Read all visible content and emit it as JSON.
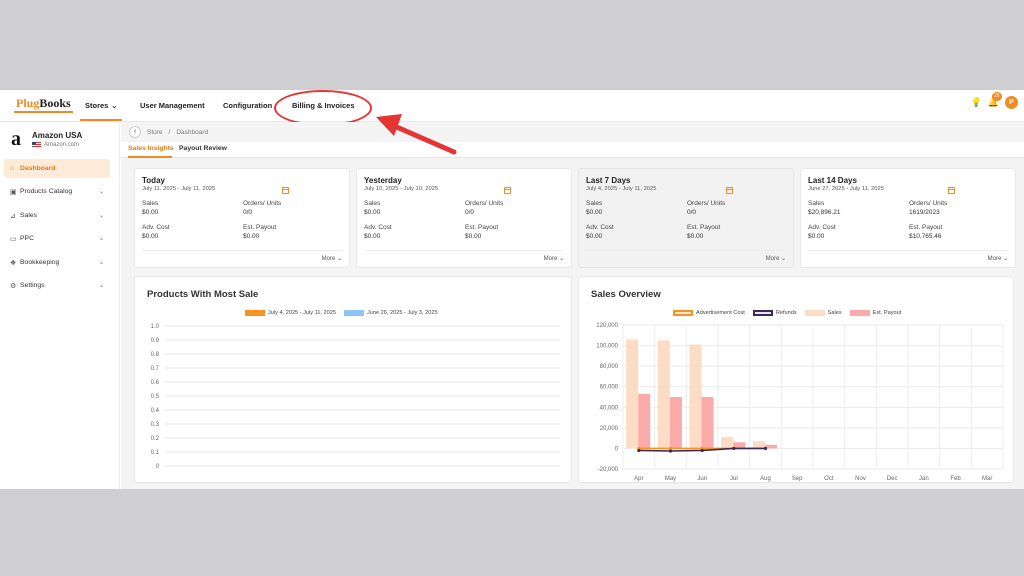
{
  "brand": {
    "logo_prefix": "Plug",
    "logo_suffix": "Books"
  },
  "topnav": {
    "items": [
      {
        "label": "Stores"
      },
      {
        "label": "User Management"
      },
      {
        "label": "Configuration"
      },
      {
        "label": "Billing & Invoices"
      }
    ],
    "notification_count": "26",
    "avatar_initial": "P"
  },
  "store": {
    "name": "Amazon USA",
    "domain": "Amazon.com"
  },
  "sidebar": {
    "items": [
      {
        "label": "Dashboard",
        "icon": "home-icon"
      },
      {
        "label": "Products Catalog",
        "icon": "box-icon"
      },
      {
        "label": "Sales",
        "icon": "sales-chart-icon"
      },
      {
        "label": "PPC",
        "icon": "ppc-icon"
      },
      {
        "label": "Bookkeeping",
        "icon": "book-icon"
      },
      {
        "label": "Settings",
        "icon": "gear-icon"
      }
    ]
  },
  "breadcrumb": {
    "parent": "Store",
    "separator": "/",
    "current": "Dashboard"
  },
  "subtabs": [
    {
      "label": "Sales Insights"
    },
    {
      "label": "Payout Review"
    }
  ],
  "cards": [
    {
      "title": "Today",
      "range": "July 11, 2025 - July 11, 2025",
      "sales_label": "Sales",
      "sales": "$0.00",
      "orders_label": "Orders/ Units",
      "orders": "0/0",
      "adv_label": "Adv. Cost",
      "adv": "$0.00",
      "payout_label": "Est. Payout",
      "payout": "$0.00",
      "more": "More"
    },
    {
      "title": "Yesterday",
      "range": "July 10, 2025 - July 10, 2025",
      "sales_label": "Sales",
      "sales": "$0.00",
      "orders_label": "Orders/ Units",
      "orders": "0/0",
      "adv_label": "Adv. Cost",
      "adv": "$0.00",
      "payout_label": "Est. Payout",
      "payout": "$0.00",
      "more": "More"
    },
    {
      "title": "Last 7 Days",
      "range": "July 4, 2025 - July 11, 2025",
      "sales_label": "Sales",
      "sales": "$0.00",
      "orders_label": "Orders/ Units",
      "orders": "0/0",
      "adv_label": "Adv. Cost",
      "adv": "$0.00",
      "payout_label": "Est. Payout",
      "payout": "$0.00",
      "more": "More"
    },
    {
      "title": "Last 14 Days",
      "range": "June 27, 2025 - July 11, 2025",
      "sales_label": "Sales",
      "sales": "$20,896.21",
      "orders_label": "Orders/ Units",
      "orders": "1619/2023",
      "adv_label": "Adv. Cost",
      "adv": "$0.00",
      "payout_label": "Est. Payout",
      "payout": "$10,765.46",
      "more": "More"
    }
  ],
  "colors": {
    "accent": "#f08a24",
    "highlight": "#e63333"
  },
  "chart_data": [
    {
      "type": "bar",
      "title": "Products With Most Sale",
      "series": [
        {
          "name": "July 4, 2025 - July 11, 2025",
          "color": "#f7931e",
          "values": []
        },
        {
          "name": "June 26, 2025 - July 3, 2025",
          "color": "#8ec5f2",
          "values": []
        }
      ],
      "ylim": [
        0,
        1.0
      ],
      "yticks": [
        "1.0",
        "0.9",
        "0.8",
        "0.7",
        "0.6",
        "0.5",
        "0.4",
        "0.3",
        "0.2",
        "0.1",
        "0"
      ],
      "grid": true
    },
    {
      "type": "bar",
      "title": "Sales Overview",
      "categories": [
        "Apr",
        "May",
        "Jun",
        "Jul",
        "Aug",
        "Sep",
        "Oct",
        "Nov",
        "Dec",
        "Jan",
        "Feb",
        "Mar"
      ],
      "series": [
        {
          "name": "Advertisement Cost",
          "kind": "line",
          "color": "#f7931e",
          "values": [
            0,
            0,
            0,
            0,
            0,
            0,
            0,
            0,
            0,
            0,
            0,
            0
          ]
        },
        {
          "name": "Refunds",
          "kind": "line",
          "color": "#3a2a55",
          "values": [
            -2000,
            -2500,
            -2000,
            0,
            0,
            0,
            0,
            0,
            0,
            0,
            0,
            0
          ]
        },
        {
          "name": "Sales",
          "kind": "bar",
          "color": "#fcdcc4",
          "values": [
            106000,
            105000,
            101000,
            11000,
            7000,
            0,
            0,
            0,
            0,
            0,
            0,
            0
          ]
        },
        {
          "name": "Est. Payout",
          "kind": "bar",
          "color": "#fbaaaa",
          "values": [
            53000,
            50000,
            50000,
            6000,
            3500,
            0,
            0,
            0,
            0,
            0,
            0,
            0
          ]
        }
      ],
      "ylim": [
        -20000,
        120000
      ],
      "yticks": [
        "120,000",
        "100,000",
        "80,000",
        "60,000",
        "40,000",
        "20,000",
        "0",
        "-20,000"
      ],
      "ytick_values": [
        120000,
        100000,
        80000,
        60000,
        40000,
        20000,
        0,
        -20000
      ],
      "grid": true,
      "legend_position": "top"
    }
  ]
}
